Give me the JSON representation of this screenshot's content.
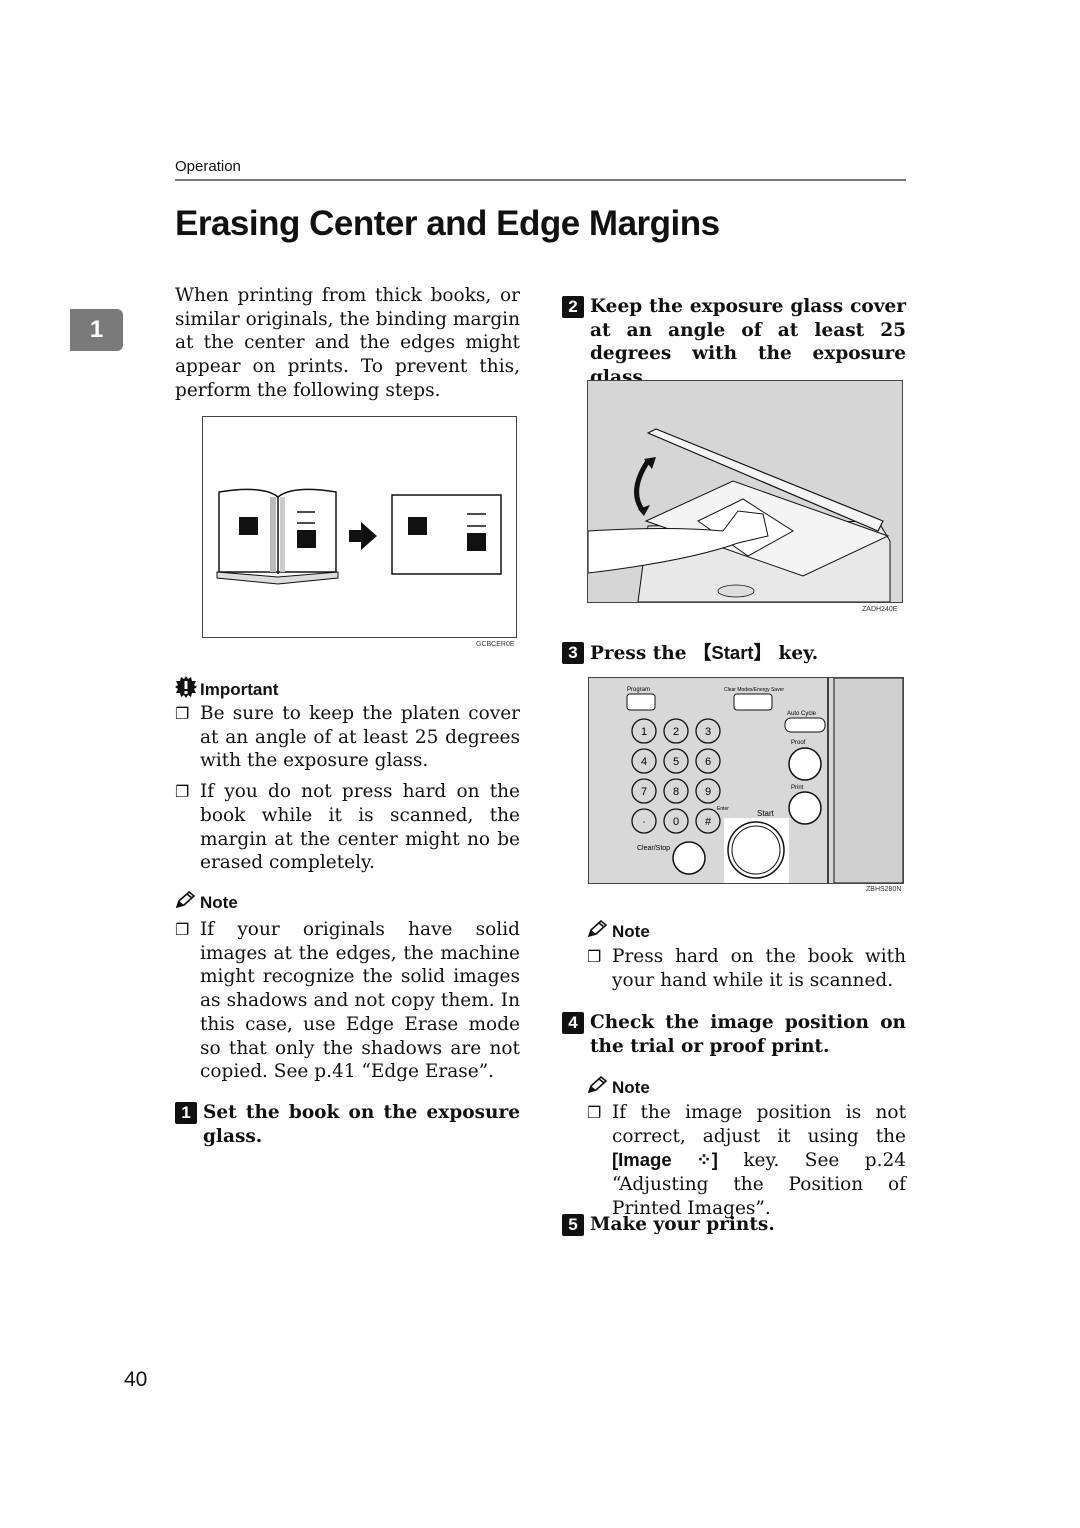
{
  "header": {
    "section_label": "Operation"
  },
  "title": "Erasing Center and Edge Margins",
  "chapter_tab": "1",
  "intro": "When printing from thick books, or similar originals, the binding margin at the center and the edges might appear on prints. To prevent this, perform the following steps.",
  "figure_book": {
    "code": "GCBCER0E"
  },
  "important": {
    "heading": "Important",
    "items": [
      "Be sure to keep the platen cover at an angle of at least 25 degrees with the exposure glass.",
      "If you do not press hard on the book while it is scanned, the margin at the center might no be erased completely."
    ]
  },
  "note1": {
    "heading": "Note",
    "items": [
      "If your originals have solid images at the edges, the machine might recognize the solid images as shadows and not copy them. In this case, use Edge Erase mode so that only the shadows are not copied. See p.41 “Edge Erase”."
    ]
  },
  "steps": [
    {
      "num": "1",
      "text": "Set the book on the exposure glass."
    },
    {
      "num": "2",
      "text": "Keep the exposure glass cover at an angle of at least 25 degrees with the exposure glass."
    },
    {
      "num": "3",
      "text_before": "Press the ",
      "key": "【Start】",
      "text_after": " key."
    },
    {
      "num": "4",
      "text": "Check the image position on the trial or proof print."
    },
    {
      "num": "5",
      "text": "Make your prints."
    }
  ],
  "figure_copier": {
    "code": "ZADH240E"
  },
  "figure_panel": {
    "code": "ZBHS280N",
    "labels": {
      "program": "Program",
      "clear_modes": "Clear Modes/Energy Saver",
      "auto_cycle": "Auto Cycle",
      "proof": "Proof",
      "print": "Print",
      "enter": "Enter",
      "start": "Start",
      "clear_stop": "Clear/Stop"
    },
    "keys": [
      "1",
      "2",
      "3",
      "4",
      "5",
      "6",
      "7",
      "8",
      "9",
      "·",
      "0",
      "#"
    ]
  },
  "note2": {
    "heading": "Note",
    "items": [
      "Press hard on the book with your hand while it is scanned."
    ]
  },
  "note3": {
    "heading": "Note",
    "item_before": "If the image position is not correct, adjust it using the ",
    "key": "[Image ⁘]",
    "item_after": " key. See p.24 “Adjusting the Position of Printed Images”."
  },
  "page_number": "40"
}
